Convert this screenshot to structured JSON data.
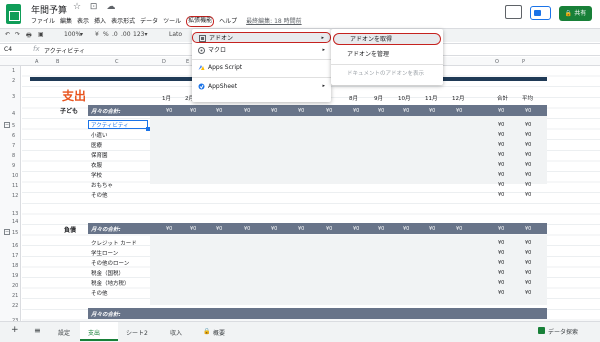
{
  "app": {
    "title": "年間予算",
    "title_icons": "☆ ⊡ ☁",
    "menus": [
      "ファイル",
      "編集",
      "表示",
      "挿入",
      "表示形式",
      "データ",
      "ツール"
    ],
    "menu_highlight": "拡張機能",
    "menu_help": "ヘルプ",
    "last_edit": "最終編集: 18 時間前",
    "share_label": "共有",
    "accent": "#188038",
    "highlight_color": "#c5221f"
  },
  "toolbar": {
    "items": [
      "↶",
      "↷",
      "🖶",
      "▣",
      "100%",
      "▾",
      "¥",
      "%",
      ".0",
      ".00",
      "123▾",
      "Lato"
    ]
  },
  "formula": {
    "cell_ref": "C4",
    "fx": "fx",
    "value": "アクティビティ"
  },
  "sheet": {
    "col_letters": [
      "A",
      "B",
      "C",
      "D",
      "E",
      "F",
      "G",
      "H",
      "I",
      "J",
      "K",
      "L",
      "M",
      "N",
      "O",
      "P"
    ],
    "heading": "支出",
    "months": [
      "1月",
      "2月",
      "3月",
      "4月",
      "5月",
      "6月",
      "7月",
      "8月",
      "9月",
      "10月",
      "11月",
      "12月",
      "合計",
      "平均"
    ],
    "row_numbers": [
      "1",
      "2",
      "3",
      "4",
      "5",
      "6",
      "7",
      "8",
      "9",
      "10",
      "11",
      "12",
      "13",
      "14",
      "15",
      "16",
      "17",
      "18",
      "19",
      "20",
      "21",
      "22",
      "23"
    ],
    "sections": [
      {
        "category": "子ども",
        "subtotal_label": "月々の合計:",
        "items": [
          "アクティビティ",
          "小遣い",
          "医療",
          "保育園",
          "衣服",
          "学校",
          "おもちゃ",
          "その他"
        ]
      },
      {
        "category": "負債",
        "subtotal_label": "月々の合計:",
        "items": [
          "クレジット カード",
          "学生ローン",
          "その他のローン",
          "税金（国税）",
          "税金（地方税）",
          "その他"
        ]
      }
    ],
    "zero": "¥0",
    "third_section_label": "月々の合計:"
  },
  "extensions_menu": {
    "items": [
      {
        "icon": "addon-icon",
        "label": "アドオン",
        "arrow": "▸"
      },
      {
        "icon": "macro-icon",
        "label": "マクロ",
        "arrow": "▸"
      },
      {
        "icon": "apps-script-icon",
        "label": "Apps Script",
        "arrow": ""
      },
      {
        "icon": "appsheet-icon",
        "label": "AppSheet",
        "arrow": "▸"
      }
    ]
  },
  "addon_submenu": {
    "items": [
      "アドオンを取得",
      "アドオンを管理",
      "ドキュメントのアドオンを表示"
    ]
  },
  "sheet_tabs": {
    "add": "+",
    "list": "≡",
    "tabs": [
      "設定",
      "支出",
      "シート2",
      "収入",
      "概要"
    ],
    "active": "支出",
    "explore": "データ探索"
  }
}
